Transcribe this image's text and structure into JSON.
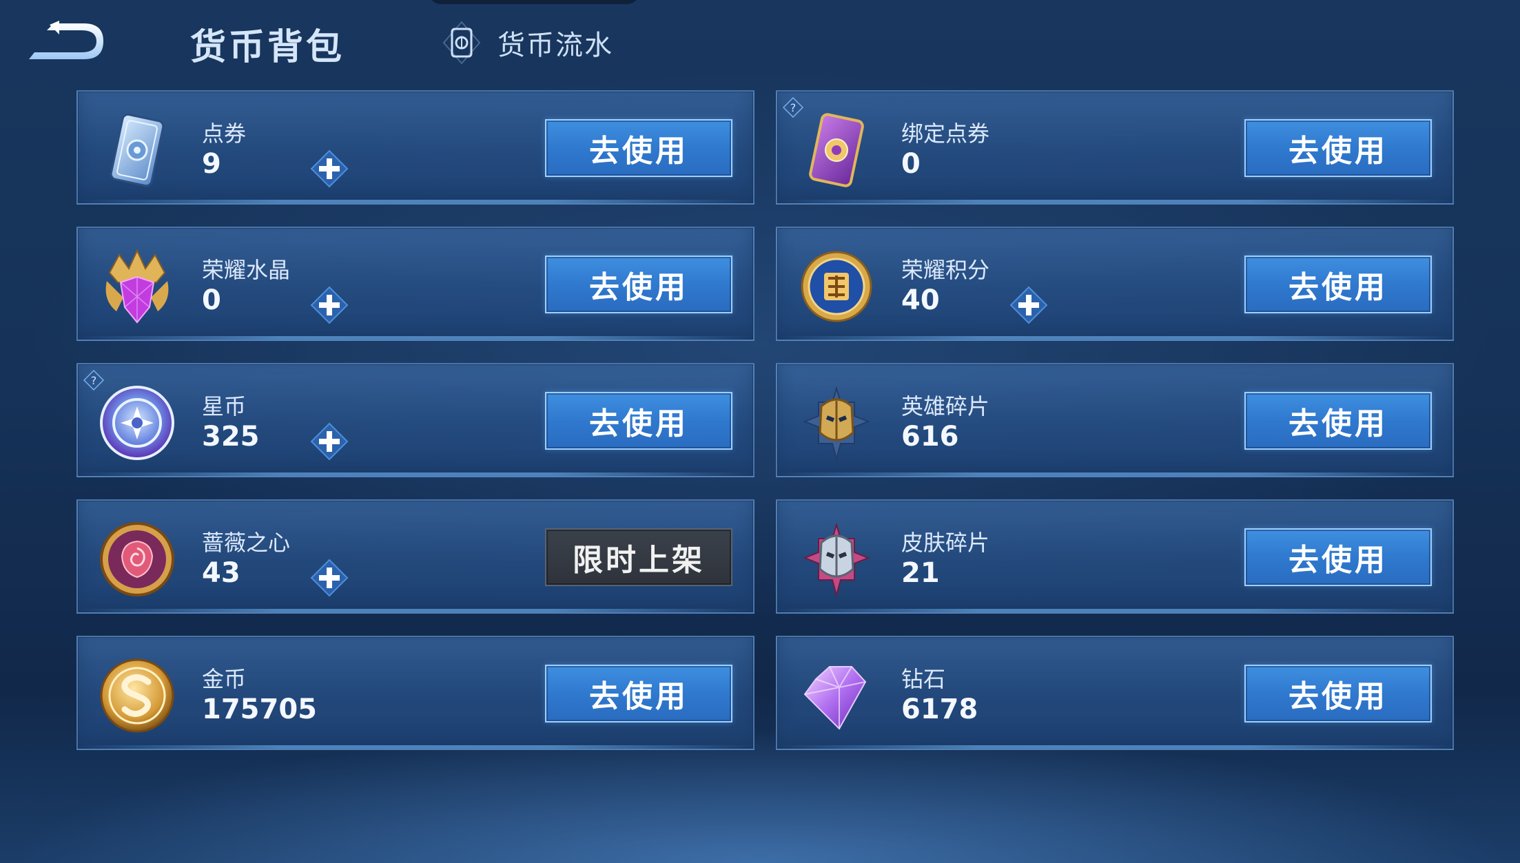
{
  "header": {
    "title": "货币背包",
    "ledger_tab_label": "货币流水",
    "back_icon": "back-arrow-icon",
    "ledger_icon": "coupon-card-icon"
  },
  "colors": {
    "accent_blue": "#2f79cf",
    "background": "#163258",
    "card": "#2f5a92",
    "disabled": "#2e333b"
  },
  "currencies": [
    {
      "name": "点券",
      "value": "9",
      "icon": "voucher-icon",
      "has_plus": true,
      "has_help": false,
      "action": "去使用",
      "action_type": "use"
    },
    {
      "name": "绑定点券",
      "value": "0",
      "icon": "bound-voucher-icon",
      "has_plus": false,
      "has_help": true,
      "action": "去使用",
      "action_type": "use"
    },
    {
      "name": "荣耀水晶",
      "value": "0",
      "icon": "glory-crystal-icon",
      "has_plus": true,
      "has_help": false,
      "action": "去使用",
      "action_type": "use"
    },
    {
      "name": "荣耀积分",
      "value": "40",
      "icon": "glory-points-icon",
      "has_plus": true,
      "has_help": false,
      "action": "去使用",
      "action_type": "use"
    },
    {
      "name": "星币",
      "value": "325",
      "icon": "star-coin-icon",
      "has_plus": true,
      "has_help": true,
      "action": "去使用",
      "action_type": "use"
    },
    {
      "name": "英雄碎片",
      "value": "616",
      "icon": "hero-fragment-icon",
      "has_plus": false,
      "has_help": false,
      "action": "去使用",
      "action_type": "use"
    },
    {
      "name": "蔷薇之心",
      "value": "43",
      "icon": "rose-heart-icon",
      "has_plus": true,
      "has_help": false,
      "action": "限时上架",
      "action_type": "limited"
    },
    {
      "name": "皮肤碎片",
      "value": "21",
      "icon": "skin-fragment-icon",
      "has_plus": false,
      "has_help": false,
      "action": "去使用",
      "action_type": "use"
    },
    {
      "name": "金币",
      "value": "175705",
      "icon": "gold-coin-icon",
      "has_plus": false,
      "has_help": false,
      "action": "去使用",
      "action_type": "use"
    },
    {
      "name": "钻石",
      "value": "6178",
      "icon": "diamond-icon",
      "has_plus": false,
      "has_help": false,
      "action": "去使用",
      "action_type": "use"
    }
  ]
}
